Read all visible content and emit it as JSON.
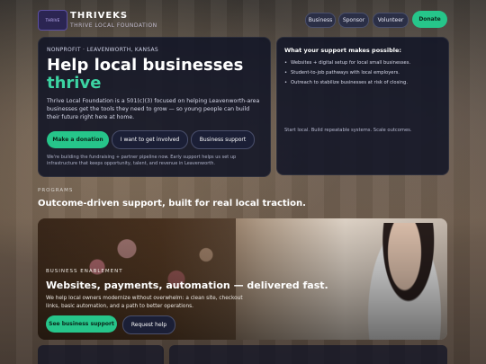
{
  "header": {
    "brand_name": "THRIVEKS",
    "brand_sub": "THRIVE LOCAL FOUNDATION",
    "logo_text": "THRIVE",
    "nav": [
      "Business",
      "Sponsor",
      "Volunteer"
    ],
    "donate_label": "Donate"
  },
  "hero": {
    "kicker": "NONPROFIT · LEAVENWORTH, KANSAS",
    "title": "Help local businesses",
    "title_accent": "thrive",
    "description": "Thrive Local Foundation is a 501(c)(3) focused on helping Leavenworth-area businesses get the tools they need to grow — so young people can build their future right here at home.",
    "buttons": {
      "donation": "Make a donation",
      "involved": "I want to get involved",
      "support": "Business support"
    },
    "note": "We're building the fundraising + partner pipeline now. Early support helps us set up infrastructure that keeps opportunity, talent, and revenue in Leavenworth."
  },
  "support_card": {
    "title": "What your support makes possible:",
    "items": [
      "Websites + digital setup for local small businesses.",
      "Student-to-job pathways with local employers.",
      "Outreach to stabilize businesses at risk of closing."
    ],
    "footer": "Start local. Build repeatable systems. Scale outcomes."
  },
  "programs": {
    "kicker": "PROGRAMS",
    "title": "Outcome-driven support, built for real local traction.",
    "card": {
      "kicker": "BUSINESS ENABLEMENT",
      "title": "Websites, payments, automation — delivered fast.",
      "description": "We help local owners modernize without overwhelm: a clean site, checkout links, basic automation, and a path to better operations.",
      "primary_btn": "See business support",
      "secondary_btn": "Request help"
    }
  },
  "colors": {
    "accent": "#26c58a",
    "accent_text": "#3cd3a2",
    "card_bg": "#11142 6"
  }
}
